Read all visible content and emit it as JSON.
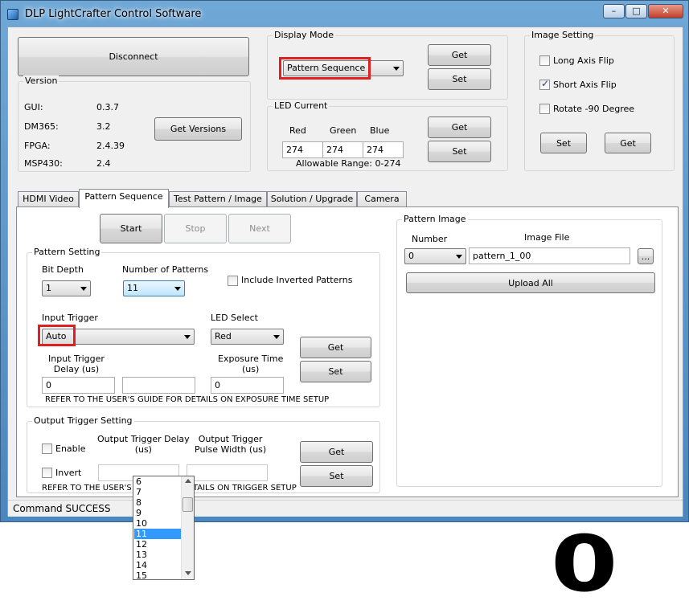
{
  "window": {
    "title": "DLP LightCrafter Control Software",
    "minimize": "–",
    "maximize": "□",
    "close": "✕"
  },
  "top": {
    "disconnect_label": "Disconnect",
    "version": {
      "title": "Version",
      "rows": [
        {
          "label": "GUI:",
          "value": "0.3.7"
        },
        {
          "label": "DM365:",
          "value": "3.2"
        },
        {
          "label": "FPGA:",
          "value": "2.4.39"
        },
        {
          "label": "MSP430:",
          "value": "2.4"
        }
      ],
      "get_versions_label": "Get Versions"
    },
    "display_mode": {
      "title": "Display Mode",
      "selected": "Pattern Sequence",
      "get_label": "Get",
      "set_label": "Set"
    },
    "led_current": {
      "title": "LED Current",
      "red_label": "Red",
      "green_label": "Green",
      "blue_label": "Blue",
      "red_value": "274",
      "green_value": "274",
      "blue_value": "274",
      "range_text": "Allowable Range: 0-274",
      "get_label": "Get",
      "set_label": "Set"
    },
    "image_setting": {
      "title": "Image Setting",
      "long_axis_flip": "Long Axis Flip",
      "short_axis_flip": "Short Axis Flip",
      "rotate": "Rotate -90 Degree",
      "set_label": "Set",
      "get_label": "Get"
    }
  },
  "tabs": [
    {
      "label": "HDMI Video"
    },
    {
      "label": "Pattern Sequence"
    },
    {
      "label": "Test Pattern / Image"
    },
    {
      "label": "Solution / Upgrade"
    },
    {
      "label": "Camera"
    }
  ],
  "pattern_tab": {
    "start_label": "Start",
    "stop_label": "Stop",
    "next_label": "Next",
    "pattern_setting": {
      "title": "Pattern Setting",
      "bit_depth_label": "Bit Depth",
      "bit_depth_value": "1",
      "num_patterns_label": "Number of Patterns",
      "num_patterns_value": "11",
      "include_inverted": "Include Inverted Patterns",
      "input_trigger_label": "Input Trigger",
      "input_trigger_value": "Auto",
      "led_select_label": "LED Select",
      "led_select_value": "Red",
      "input_trigger_delay_label": "Input Trigger\nDelay (us)",
      "input_trigger_delay_value": "0",
      "exposure_time_label": "Exposure Time\n(us)",
      "exposure_time_value": "0",
      "note": "REFER TO THE USER'S GUIDE FOR DETAILS ON EXPOSURE TIME SETUP",
      "get_label": "Get",
      "set_label": "Set",
      "dropdown_options": [
        "6",
        "7",
        "8",
        "9",
        "10",
        "11",
        "12",
        "13",
        "14",
        "15"
      ],
      "dropdown_selected": "11"
    },
    "output_trigger": {
      "title": "Output Trigger Setting",
      "enable": "Enable",
      "invert": "Invert",
      "delay_label": "Output Trigger Delay\n(us)",
      "pulse_label": "Output Trigger\nPulse Width (us)",
      "note": "REFER TO THE USER'S GUIDE FOR DETAILS ON TRIGGER SETUP",
      "get_label": "Get",
      "set_label": "Set"
    },
    "pattern_image": {
      "title": "Pattern Image",
      "number_label": "Number",
      "number_value": "0",
      "image_file_label": "Image File",
      "image_file_value": "pattern_1_00",
      "browse_label": "...",
      "upload_all_label": "Upload All",
      "preview_text": "0"
    }
  },
  "status": {
    "text": "Command SUCCESS"
  },
  "colors": {
    "highlight_box": "#e02020",
    "selection": "#3399ff",
    "titlebar": "#5b97cc"
  }
}
